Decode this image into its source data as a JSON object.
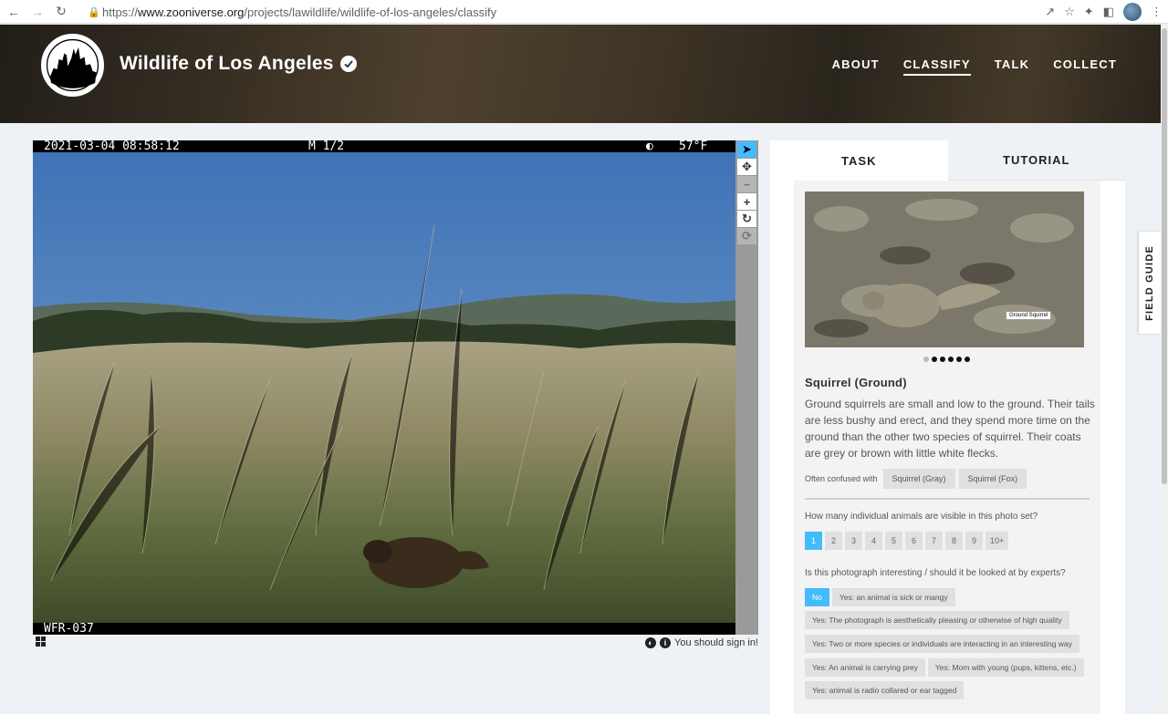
{
  "browser": {
    "url_scheme": "https://",
    "url_host": "www.zooniverse.org",
    "url_path": "/projects/lawildlife/wildlife-of-los-angeles/classify"
  },
  "header": {
    "title": "Wildlife of Los Angeles",
    "nav": [
      "ABOUT",
      "CLASSIFY",
      "TALK",
      "COLLECT"
    ],
    "active_nav": "CLASSIFY"
  },
  "subject": {
    "timestamp": "2021-03-04 08:58:12",
    "frame": "M 1/2",
    "temperature": "57°F",
    "camera_id": "WFR-037"
  },
  "viewer_tools": [
    "pointer-icon",
    "pan-icon",
    "zoom-out-icon",
    "zoom-in-icon",
    "rotate-icon",
    "reset-icon"
  ],
  "viewer_footer": {
    "signin_text": "You should sign in!"
  },
  "panel": {
    "tabs": [
      "TASK",
      "TUTORIAL"
    ],
    "active_tab": "TASK",
    "guide": {
      "sample_tag": "Ground Squirrel",
      "species_name": "Squirrel (Ground)",
      "description": "Ground squirrels are small and low to the ground. Their tails are less bushy and erect, and they spend more time on the ground than the other two species of squirrel. Their coats are grey or brown with little white flecks.",
      "confused_label": "Often confused with",
      "confused_with": [
        "Squirrel (Gray)",
        "Squirrel (Fox)"
      ],
      "dot_count": 6,
      "active_dot": 0
    },
    "question_count": "How many individual animals are visible in this photo set?",
    "count_options": [
      "1",
      "2",
      "3",
      "4",
      "5",
      "6",
      "7",
      "8",
      "9",
      "10+"
    ],
    "count_selected": "1",
    "question_interesting": "Is this photograph interesting / should it be looked at by experts?",
    "interesting_options": [
      "No",
      "Yes: an animal is sick or mangy",
      "Yes: The photograph is aesthetically pleasing or otherwise of high quality",
      "Yes: Two or more species or individuals are interacting in an interesting way",
      "Yes: An animal is carrying prey",
      "Yes: Mom with young (pups, kittens, etc.)",
      "Yes: animal is radio collared or ear tagged"
    ],
    "interesting_selected": "No"
  },
  "field_guide_label": "FIELD GUIDE",
  "colors": {
    "accent": "#43bbfd",
    "page_bg": "#eef1f5"
  }
}
